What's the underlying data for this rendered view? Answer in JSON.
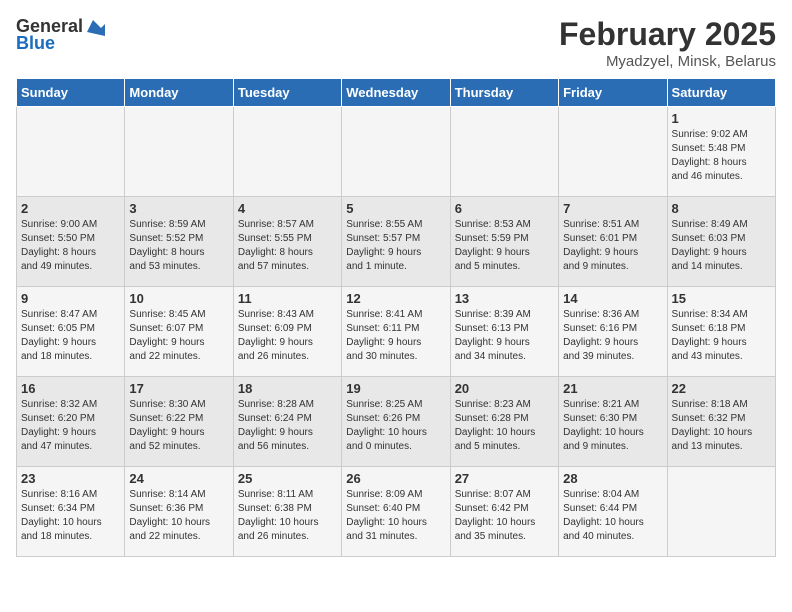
{
  "app": {
    "logo_general": "General",
    "logo_blue": "Blue"
  },
  "header": {
    "title": "February 2025",
    "subtitle": "Myadzyel, Minsk, Belarus"
  },
  "weekdays": [
    "Sunday",
    "Monday",
    "Tuesday",
    "Wednesday",
    "Thursday",
    "Friday",
    "Saturday"
  ],
  "weeks": [
    [
      {
        "day": "",
        "detail": ""
      },
      {
        "day": "",
        "detail": ""
      },
      {
        "day": "",
        "detail": ""
      },
      {
        "day": "",
        "detail": ""
      },
      {
        "day": "",
        "detail": ""
      },
      {
        "day": "",
        "detail": ""
      },
      {
        "day": "1",
        "detail": "Sunrise: 9:02 AM\nSunset: 5:48 PM\nDaylight: 8 hours\nand 46 minutes."
      }
    ],
    [
      {
        "day": "2",
        "detail": "Sunrise: 9:00 AM\nSunset: 5:50 PM\nDaylight: 8 hours\nand 49 minutes."
      },
      {
        "day": "3",
        "detail": "Sunrise: 8:59 AM\nSunset: 5:52 PM\nDaylight: 8 hours\nand 53 minutes."
      },
      {
        "day": "4",
        "detail": "Sunrise: 8:57 AM\nSunset: 5:55 PM\nDaylight: 8 hours\nand 57 minutes."
      },
      {
        "day": "5",
        "detail": "Sunrise: 8:55 AM\nSunset: 5:57 PM\nDaylight: 9 hours\nand 1 minute."
      },
      {
        "day": "6",
        "detail": "Sunrise: 8:53 AM\nSunset: 5:59 PM\nDaylight: 9 hours\nand 5 minutes."
      },
      {
        "day": "7",
        "detail": "Sunrise: 8:51 AM\nSunset: 6:01 PM\nDaylight: 9 hours\nand 9 minutes."
      },
      {
        "day": "8",
        "detail": "Sunrise: 8:49 AM\nSunset: 6:03 PM\nDaylight: 9 hours\nand 14 minutes."
      }
    ],
    [
      {
        "day": "9",
        "detail": "Sunrise: 8:47 AM\nSunset: 6:05 PM\nDaylight: 9 hours\nand 18 minutes."
      },
      {
        "day": "10",
        "detail": "Sunrise: 8:45 AM\nSunset: 6:07 PM\nDaylight: 9 hours\nand 22 minutes."
      },
      {
        "day": "11",
        "detail": "Sunrise: 8:43 AM\nSunset: 6:09 PM\nDaylight: 9 hours\nand 26 minutes."
      },
      {
        "day": "12",
        "detail": "Sunrise: 8:41 AM\nSunset: 6:11 PM\nDaylight: 9 hours\nand 30 minutes."
      },
      {
        "day": "13",
        "detail": "Sunrise: 8:39 AM\nSunset: 6:13 PM\nDaylight: 9 hours\nand 34 minutes."
      },
      {
        "day": "14",
        "detail": "Sunrise: 8:36 AM\nSunset: 6:16 PM\nDaylight: 9 hours\nand 39 minutes."
      },
      {
        "day": "15",
        "detail": "Sunrise: 8:34 AM\nSunset: 6:18 PM\nDaylight: 9 hours\nand 43 minutes."
      }
    ],
    [
      {
        "day": "16",
        "detail": "Sunrise: 8:32 AM\nSunset: 6:20 PM\nDaylight: 9 hours\nand 47 minutes."
      },
      {
        "day": "17",
        "detail": "Sunrise: 8:30 AM\nSunset: 6:22 PM\nDaylight: 9 hours\nand 52 minutes."
      },
      {
        "day": "18",
        "detail": "Sunrise: 8:28 AM\nSunset: 6:24 PM\nDaylight: 9 hours\nand 56 minutes."
      },
      {
        "day": "19",
        "detail": "Sunrise: 8:25 AM\nSunset: 6:26 PM\nDaylight: 10 hours\nand 0 minutes."
      },
      {
        "day": "20",
        "detail": "Sunrise: 8:23 AM\nSunset: 6:28 PM\nDaylight: 10 hours\nand 5 minutes."
      },
      {
        "day": "21",
        "detail": "Sunrise: 8:21 AM\nSunset: 6:30 PM\nDaylight: 10 hours\nand 9 minutes."
      },
      {
        "day": "22",
        "detail": "Sunrise: 8:18 AM\nSunset: 6:32 PM\nDaylight: 10 hours\nand 13 minutes."
      }
    ],
    [
      {
        "day": "23",
        "detail": "Sunrise: 8:16 AM\nSunset: 6:34 PM\nDaylight: 10 hours\nand 18 minutes."
      },
      {
        "day": "24",
        "detail": "Sunrise: 8:14 AM\nSunset: 6:36 PM\nDaylight: 10 hours\nand 22 minutes."
      },
      {
        "day": "25",
        "detail": "Sunrise: 8:11 AM\nSunset: 6:38 PM\nDaylight: 10 hours\nand 26 minutes."
      },
      {
        "day": "26",
        "detail": "Sunrise: 8:09 AM\nSunset: 6:40 PM\nDaylight: 10 hours\nand 31 minutes."
      },
      {
        "day": "27",
        "detail": "Sunrise: 8:07 AM\nSunset: 6:42 PM\nDaylight: 10 hours\nand 35 minutes."
      },
      {
        "day": "28",
        "detail": "Sunrise: 8:04 AM\nSunset: 6:44 PM\nDaylight: 10 hours\nand 40 minutes."
      },
      {
        "day": "",
        "detail": ""
      }
    ]
  ]
}
